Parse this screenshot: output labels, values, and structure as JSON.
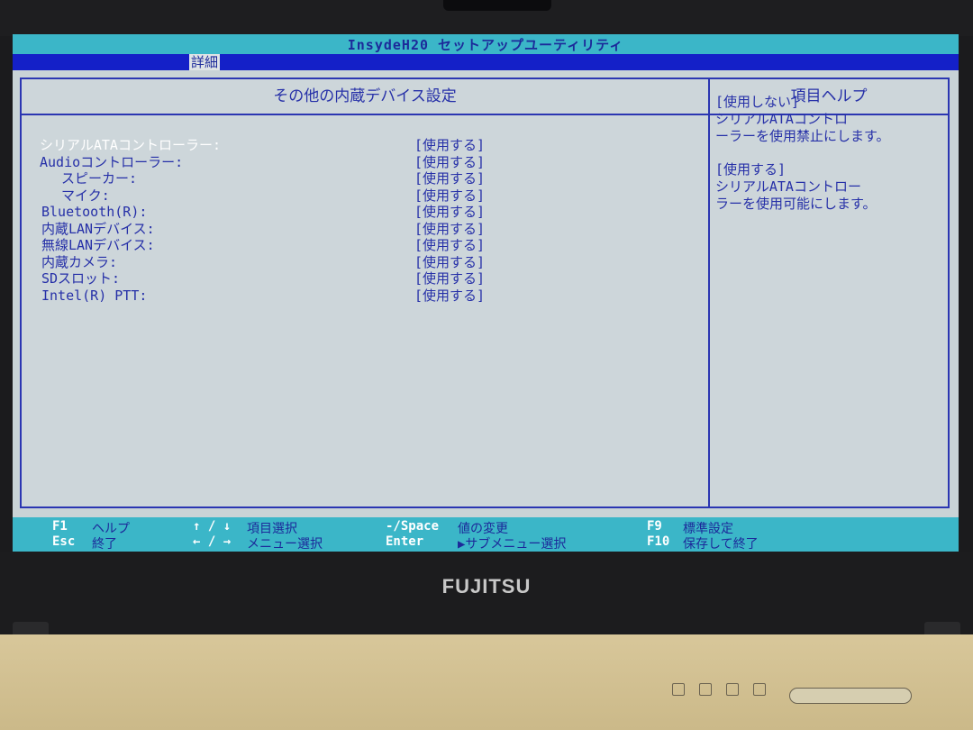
{
  "title": "InsydeH20 セットアップユーティリティ",
  "menu": {
    "active_tab": "詳細"
  },
  "main": {
    "heading": "その他の内蔵デバイス設定",
    "settings": [
      {
        "label": "シリアルATAコントローラー:",
        "value": "[使用する]",
        "indent": 0,
        "selected": true
      },
      {
        "label": "Audioコントローラー:",
        "value": "[使用する]",
        "indent": 0,
        "selected": false
      },
      {
        "label": "スピーカー:",
        "value": "[使用する]",
        "indent": 2,
        "selected": false
      },
      {
        "label": "マイク:",
        "value": "[使用する]",
        "indent": 2,
        "selected": false
      },
      {
        "label": "Bluetooth(R):",
        "value": "[使用する]",
        "indent": 0,
        "selected": false
      },
      {
        "label": "内蔵LANデバイス:",
        "value": "[使用する]",
        "indent": 0,
        "selected": false
      },
      {
        "label": "無線LANデバイス:",
        "value": "[使用する]",
        "indent": 0,
        "selected": false
      },
      {
        "label": "内蔵カメラ:",
        "value": "[使用する]",
        "indent": 0,
        "selected": false
      },
      {
        "label": "SDスロット:",
        "value": "[使用する]",
        "indent": 0,
        "selected": false
      },
      {
        "label": "Intel(R) PTT:",
        "value": "[使用する]",
        "indent": 0,
        "selected": false
      }
    ]
  },
  "help": {
    "heading": "項目ヘルプ",
    "blocks": [
      {
        "option": "[使用しない]",
        "lines": [
          "シリアルATAコントロ",
          "ーラーを使用禁止にします。"
        ]
      },
      {
        "option": "[使用する]",
        "lines": [
          "シリアルATAコントロー",
          "ラーを使用可能にします。"
        ]
      }
    ]
  },
  "footer": {
    "keys": [
      {
        "key": "F1",
        "desc": "ヘルプ"
      },
      {
        "key": "Esc",
        "desc": "終了"
      },
      {
        "key": "↑ / ↓",
        "desc": "項目選択"
      },
      {
        "key": "← / →",
        "desc": "メニュー選択"
      },
      {
        "key": "-/Space",
        "desc": "値の変更"
      },
      {
        "key": "Enter",
        "desc": "▶サブメニュー選択"
      },
      {
        "key": "F9",
        "desc": "標準設定"
      },
      {
        "key": "F10",
        "desc": "保存して終了"
      }
    ]
  },
  "brand": "FUJITSU",
  "colors": {
    "text_blue": "#2630a8",
    "accent_cyan": "#3bb6c8",
    "menu_blue": "#1420c8",
    "panel_bg": "#cdd6da"
  }
}
